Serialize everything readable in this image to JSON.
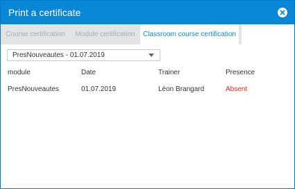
{
  "dialog": {
    "title": "Print a certificate",
    "close_icon": "close-circle-icon"
  },
  "tabs": [
    {
      "label": "Course certification",
      "active": false
    },
    {
      "label": "Module certification",
      "active": false
    },
    {
      "label": "Classroom course certification",
      "active": true
    }
  ],
  "session_select": {
    "value": "PresNouveautes - 01.07.2019"
  },
  "table": {
    "headers": [
      "module",
      "Date",
      "Trainer",
      "Presence"
    ],
    "rows": [
      {
        "module": "PresNouveautes",
        "date": "01.07.2019",
        "trainer": "Léon Brangard",
        "presence": "Absent"
      }
    ]
  },
  "colors": {
    "accent": "#0a86d6",
    "tab_inactive_bg": "#e1e3e5",
    "absent": "#e3242b"
  }
}
